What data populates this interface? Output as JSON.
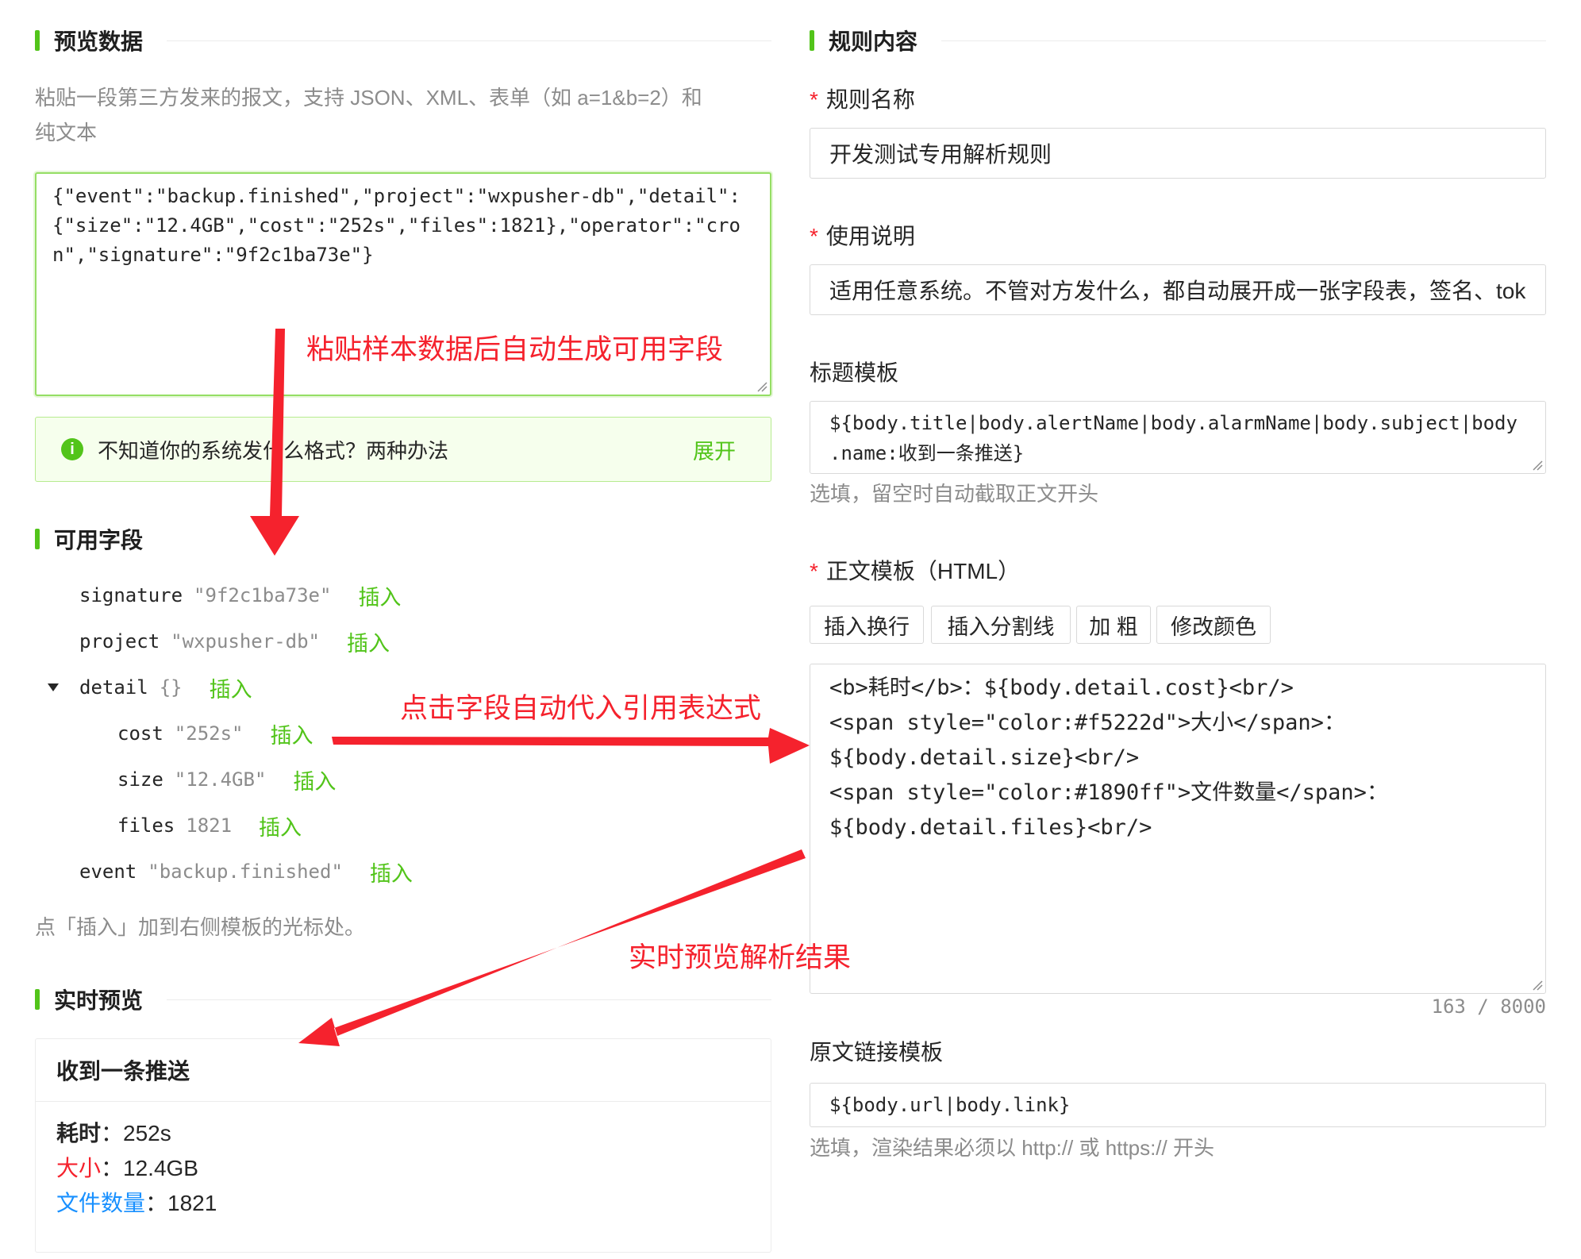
{
  "left": {
    "preview_section": {
      "title": "预览数据"
    },
    "paste_help": [
      "粘贴一段第三方发来的报文，支持 JSON、XML、表单（如 a=1&b=2）和",
      "纯文本"
    ],
    "paste_lines": [
      "{\"event\":\"backup.finished\",\"project\":\"wxpusher-db\",\"detail\":",
      "{\"size\":\"12.4GB\",\"cost\":\"252s\",\"files\":1821},\"operator\":\"cro",
      "n\",\"signature\":\"9f2c1ba73e\"}"
    ],
    "alert": {
      "text": "不知道你的系统发什么格式？两种办法",
      "toggle": "展开"
    },
    "fields_section": {
      "title": "可用字段"
    },
    "fields": [
      {
        "key": "signature",
        "value": "\"9f2c1ba73e\"",
        "insert": "插入"
      },
      {
        "key": "project",
        "value": "\"wxpusher-db\"",
        "insert": "插入"
      },
      {
        "key": "detail",
        "value": "{}",
        "insert": "插入"
      },
      {
        "key": "cost",
        "value": "\"252s\"",
        "insert": "插入"
      },
      {
        "key": "size",
        "value": "\"12.4GB\"",
        "insert": "插入"
      },
      {
        "key": "files",
        "value": "1821",
        "insert": "插入"
      },
      {
        "key": "event",
        "value": "\"backup.finished\"",
        "insert": "插入"
      }
    ],
    "fields_hint": "点「插入」加到右侧模板的光标处。",
    "live_section": {
      "title": "实时预览"
    },
    "preview": {
      "title": "收到一条推送",
      "lines": [
        {
          "label": "耗时",
          "sep": "：",
          "value": "252s",
          "color": "#262626"
        },
        {
          "label": "大小",
          "sep": "：",
          "value": "12.4GB",
          "color": "#f5222d"
        },
        {
          "label": "文件数量",
          "sep": "：",
          "value": "1821",
          "color": "#1890ff"
        }
      ]
    }
  },
  "right": {
    "rule_section": {
      "title": "规则内容"
    },
    "name": {
      "label": "规则名称",
      "value": "开发测试专用解析规则"
    },
    "desc": {
      "label": "使用说明",
      "value": "适用任意系统。不管对方发什么，都自动展开成一张字段表，签名、tok"
    },
    "title_tpl": {
      "label": "标题模板",
      "lines": [
        "${body.title|body.alertName|body.alarmName|body.subject|body",
        ".name:收到一条推送}"
      ],
      "help": "选填，留空时自动截取正文开头"
    },
    "body_tpl": {
      "label": "正文模板（HTML）",
      "buttons": [
        "插入换行",
        "插入分割线",
        "加 粗",
        "修改颜色"
      ],
      "lines": [
        "<b>耗时</b>：${body.detail.cost}<br/>",
        "<span style=\"color:#f5222d\">大小</span>：",
        "${body.detail.size}<br/>",
        "<span style=\"color:#1890ff\">文件数量</span>：",
        "${body.detail.files}<br/>"
      ],
      "counter": "163 / 8000"
    },
    "link_tpl": {
      "label": "原文链接模板",
      "value": "${body.url|body.link}",
      "help": "选填，渲染结果必须以 http:// 或 https:// 开头"
    }
  },
  "annotations": {
    "paste": "粘贴样本数据后自动生成可用字段",
    "click": "点击字段自动代入引用表达式",
    "preview": "实时预览解析结果"
  },
  "colors": {
    "accent": "#52c41a",
    "required": "#f5222d",
    "annotation": "#f5222d",
    "link_blue": "#1890ff"
  }
}
